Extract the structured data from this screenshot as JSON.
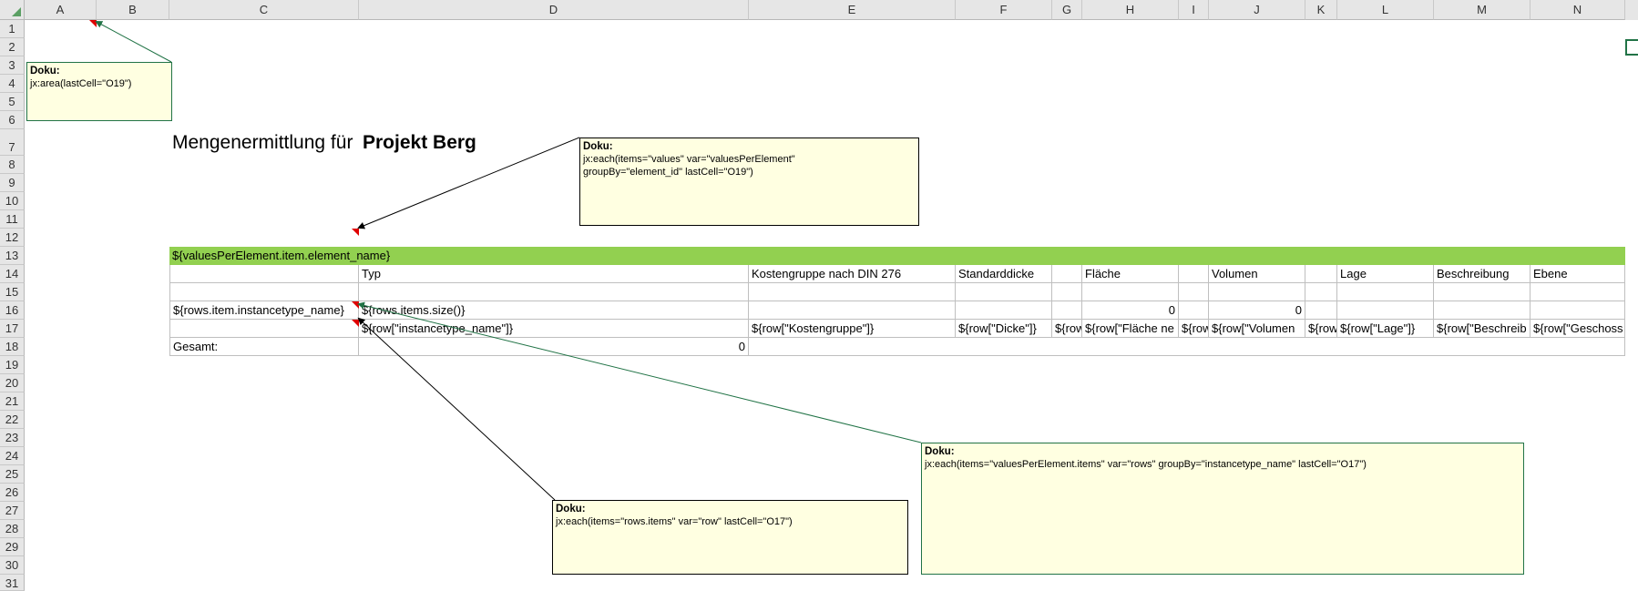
{
  "columns": [
    "A",
    "B",
    "C",
    "D",
    "E",
    "F",
    "G",
    "H",
    "I",
    "J",
    "K",
    "L",
    "M",
    "N"
  ],
  "rows": [
    "1",
    "2",
    "3",
    "4",
    "5",
    "6",
    "7",
    "8",
    "9",
    "10",
    "11",
    "12",
    "13",
    "14",
    "15",
    "16",
    "17",
    "18",
    "19",
    "20",
    "21",
    "22",
    "23",
    "24",
    "25",
    "26",
    "27",
    "28",
    "29",
    "30",
    "31"
  ],
  "heading": {
    "label": "Mengenermittlung für",
    "project": "Projekt Berg"
  },
  "group_row": {
    "text": "${valuesPerElement.item.element_name}"
  },
  "header_row": {
    "typ": "Typ",
    "kostengruppe": "Kostengruppe nach DIN 276",
    "standarddicke": "Standarddicke",
    "flaeche": "Fläche",
    "volumen": "Volumen",
    "lage": "Lage",
    "beschreibung": "Beschreibung",
    "ebene": "Ebene"
  },
  "row16": {
    "c": "${rows.item.instancetype_name}",
    "d": "${rows.items.size()}",
    "h": "0",
    "j": "0"
  },
  "row17": {
    "d": "${row[\"instancetype_name\"]}",
    "e": "${row[\"Kostengruppe\"]}",
    "f": "${row[\"Dicke\"]}",
    "g": "${row",
    "h": "${row[\"Fläche ne",
    "i": "${row",
    "j": "${row[\"Volumen",
    "k": "${row",
    "l": "${row[\"Lage\"]}",
    "m": "${row[\"Beschreib",
    "n": "${row[\"Geschoss ID"
  },
  "row18": {
    "c": "Gesamt:",
    "d": "0"
  },
  "comments": [
    {
      "title": "Doku:",
      "body": "jx:area(lastCell=\"O19\")"
    },
    {
      "title": "Doku:",
      "body": "jx:each(items=\"values\" var=\"valuesPerElement\"\ngroupBy=\"element_id\" lastCell=\"O19\")"
    },
    {
      "title": "Doku:",
      "body": "jx:each(items=\"rows.items\" var=\"row\" lastCell=\"O17\")"
    },
    {
      "title": "Doku:",
      "body": "jx:each(items=\"valuesPerElement.items\" var=\"rows\" groupBy=\"instancetype_name\" lastCell=\"O17\")"
    }
  ],
  "colors": {
    "group_fill": "#92d050",
    "comment_fill": "#ffffe1",
    "comment_marker": "#e00000",
    "selection_green": "#217346"
  }
}
